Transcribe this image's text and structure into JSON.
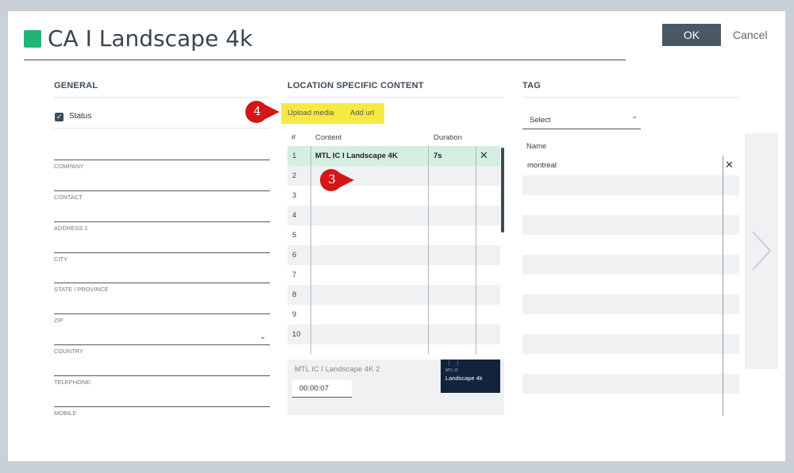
{
  "dialog": {
    "title": "CA I Landscape 4k",
    "title_color": "#21b573",
    "ok_label": "OK",
    "cancel_label": "Cancel"
  },
  "general": {
    "heading": "GENERAL",
    "status_label": "Status",
    "status_checked": true,
    "fields": [
      {
        "label": "COMPANY",
        "value": ""
      },
      {
        "label": "CONTACT",
        "value": ""
      },
      {
        "label": "ADDRESS 1",
        "value": ""
      },
      {
        "label": "CITY",
        "value": ""
      },
      {
        "label": "STATE / PROVINCE",
        "value": ""
      },
      {
        "label": "ZIP",
        "value": ""
      },
      {
        "label": "COUNTRY",
        "value": ""
      },
      {
        "label": "TELEPHONE:",
        "value": ""
      },
      {
        "label": "MOBILE",
        "value": ""
      }
    ]
  },
  "location": {
    "heading": "LOCATION SPECIFIC CONTENT",
    "upload_label": "Upload media",
    "add_url_label": "Add url",
    "col_num": "#",
    "col_content": "Content",
    "col_duration": "Duration",
    "rows": [
      {
        "num": "1",
        "content": "MTL IC I Landscape 4K",
        "duration": "7s",
        "remove": "✕",
        "selected": true
      },
      {
        "num": "2",
        "content": "",
        "duration": "",
        "remove": ""
      },
      {
        "num": "3",
        "content": "",
        "duration": "",
        "remove": ""
      },
      {
        "num": "4",
        "content": "",
        "duration": "",
        "remove": ""
      },
      {
        "num": "5",
        "content": "",
        "duration": "",
        "remove": ""
      },
      {
        "num": "6",
        "content": "",
        "duration": "",
        "remove": ""
      },
      {
        "num": "7",
        "content": "",
        "duration": "",
        "remove": ""
      },
      {
        "num": "8",
        "content": "",
        "duration": "",
        "remove": ""
      },
      {
        "num": "9",
        "content": "",
        "duration": "",
        "remove": ""
      },
      {
        "num": "10",
        "content": "",
        "duration": "",
        "remove": ""
      },
      {
        "num": "",
        "content": "",
        "duration": "",
        "remove": ""
      }
    ],
    "preview_name": "MTL IC I Landscape 4K 2",
    "preview_duration": "00:00:07",
    "thumb_small": "MTL IC",
    "thumb_text": "Landscape 4k",
    "selected_row_color": "#d4eee0"
  },
  "tag": {
    "heading": "TAG",
    "select_label": "Select",
    "name_header": "Name",
    "rows": [
      "montreal",
      "",
      "",
      "",
      "",
      "",
      "",
      "",
      "",
      "",
      "",
      "",
      ""
    ]
  },
  "markers": {
    "upload_marker": "4",
    "row_marker": "3",
    "color": "#d51616"
  },
  "icons": {
    "check": "✓",
    "chevron_down": "⌄",
    "close": "✕",
    "chevron_right": "chevron-right-icon"
  }
}
